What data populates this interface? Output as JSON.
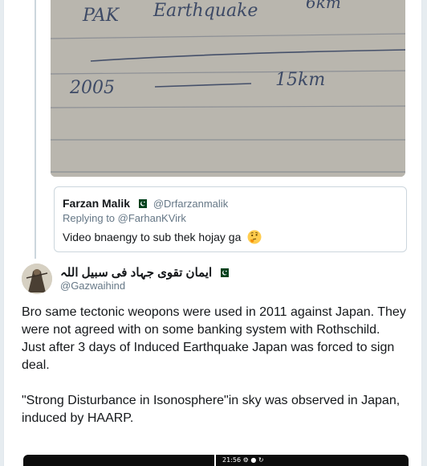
{
  "photo": {
    "handwriting": {
      "line1_word1": "PAK",
      "line1_word2": "Earthquake",
      "line1_word3": "6km",
      "line2_word1": "2005",
      "line2_word2": "15km"
    }
  },
  "quoted_tweet": {
    "name": "Farzan Malik",
    "handle": "@Drfarzanmalik",
    "replying_prefix": "Replying to",
    "replying_handle": "@FarhanKVirk",
    "text": "Video bnaengy to sub thek hojay ga",
    "emoji": "thinking-face"
  },
  "tweet": {
    "author_name": "ایمان تقوی جہاد فی سبیل اللہ",
    "author_handle": "@Gazwaihind",
    "paragraphs": [
      "Bro same tectonic weopons were used in 2011 against Japan. They were not agreed with on some banking system with Rothschild.",
      "Just after 3 days of Induced Earthquake Japan was forced to sign deal.",
      "\"Strong Disturbance in Isonosphere\"in sky was observed in Japan, induced by HAARP."
    ]
  },
  "media_preview": {
    "status_time": "21:56"
  },
  "colors": {
    "text": "#14171a",
    "muted": "#657786",
    "border": "#ccd6dd",
    "flag_green": "#01411c"
  }
}
